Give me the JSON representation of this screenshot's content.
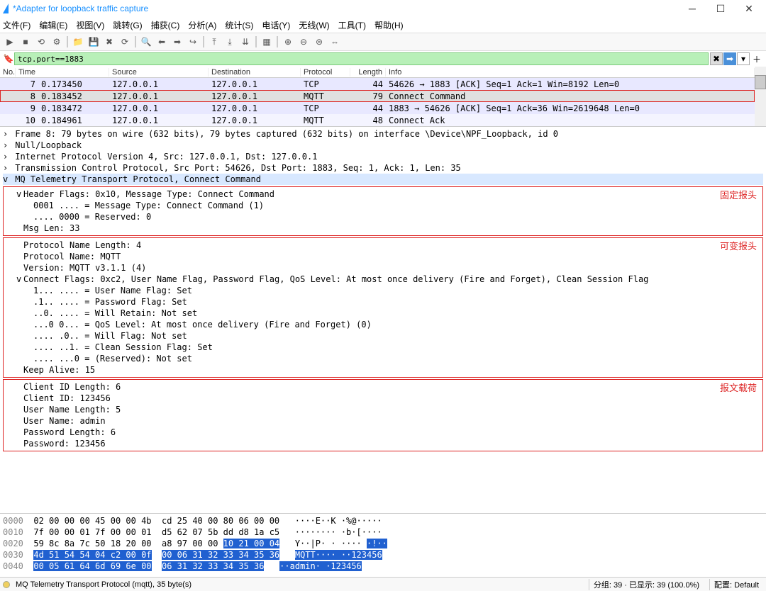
{
  "title": "*Adapter for loopback traffic capture",
  "menu": [
    "文件(F)",
    "编辑(E)",
    "视图(V)",
    "跳转(G)",
    "捕获(C)",
    "分析(A)",
    "统计(S)",
    "电话(Y)",
    "无线(W)",
    "工具(T)",
    "帮助(H)"
  ],
  "filter": "tcp.port==1883",
  "columns": [
    "No.",
    "Time",
    "Source",
    "Destination",
    "Protocol",
    "Length",
    "Info"
  ],
  "packets": [
    {
      "no": "7",
      "time": "0.173450",
      "src": "127.0.0.1",
      "dst": "127.0.0.1",
      "proto": "TCP",
      "len": "44",
      "info": "54626 → 1883 [ACK] Seq=1 Ack=1 Win=8192 Len=0",
      "cls": "odd"
    },
    {
      "no": "8",
      "time": "0.183452",
      "src": "127.0.0.1",
      "dst": "127.0.0.1",
      "proto": "MQTT",
      "len": "79",
      "info": "Connect Command",
      "cls": "selected sel-border"
    },
    {
      "no": "9",
      "time": "0.183472",
      "src": "127.0.0.1",
      "dst": "127.0.0.1",
      "proto": "TCP",
      "len": "44",
      "info": "1883 → 54626 [ACK] Seq=1 Ack=36 Win=2619648 Len=0",
      "cls": "odd"
    },
    {
      "no": "10",
      "time": "0.184961",
      "src": "127.0.0.1",
      "dst": "127.0.0.1",
      "proto": "MQTT",
      "len": "48",
      "info": "Connect Ack",
      "cls": "even"
    }
  ],
  "details_top": [
    "Frame 8: 79 bytes on wire (632 bits), 79 bytes captured (632 bits) on interface \\Device\\NPF_Loopback, id 0",
    "Null/Loopback",
    "Internet Protocol Version 4, Src: 127.0.0.1, Dst: 127.0.0.1",
    "Transmission Control Protocol, Src Port: 54626, Dst Port: 1883, Seq: 1, Ack: 1, Len: 35"
  ],
  "details_hl": "MQ Telemetry Transport Protocol, Connect Command",
  "box1_label": "固定报头",
  "box1_lines": [
    {
      "lvl": 1,
      "tri": "v",
      "text": "Header Flags: 0x10, Message Type: Connect Command"
    },
    {
      "lvl": 2,
      "tri": "",
      "text": "0001 .... = Message Type: Connect Command (1)"
    },
    {
      "lvl": 2,
      "tri": "",
      "text": ".... 0000 = Reserved: 0"
    },
    {
      "lvl": 1,
      "tri": "",
      "text": "Msg Len: 33"
    }
  ],
  "box2_label": "可变报头",
  "box2_lines": [
    {
      "lvl": 1,
      "tri": "",
      "text": "Protocol Name Length: 4"
    },
    {
      "lvl": 1,
      "tri": "",
      "text": "Protocol Name: MQTT"
    },
    {
      "lvl": 1,
      "tri": "",
      "text": "Version: MQTT v3.1.1 (4)"
    },
    {
      "lvl": 1,
      "tri": "v",
      "text": "Connect Flags: 0xc2, User Name Flag, Password Flag, QoS Level: At most once delivery (Fire and Forget), Clean Session Flag"
    },
    {
      "lvl": 2,
      "tri": "",
      "text": "1... .... = User Name Flag: Set"
    },
    {
      "lvl": 2,
      "tri": "",
      "text": ".1.. .... = Password Flag: Set"
    },
    {
      "lvl": 2,
      "tri": "",
      "text": "..0. .... = Will Retain: Not set"
    },
    {
      "lvl": 2,
      "tri": "",
      "text": "...0 0... = QoS Level: At most once delivery (Fire and Forget) (0)"
    },
    {
      "lvl": 2,
      "tri": "",
      "text": ".... .0.. = Will Flag: Not set"
    },
    {
      "lvl": 2,
      "tri": "",
      "text": ".... ..1. = Clean Session Flag: Set"
    },
    {
      "lvl": 2,
      "tri": "",
      "text": ".... ...0 = (Reserved): Not set"
    },
    {
      "lvl": 1,
      "tri": "",
      "text": "Keep Alive: 15"
    }
  ],
  "box3_label": "报文载荷",
  "box3_lines": [
    {
      "lvl": 1,
      "tri": "",
      "text": "Client ID Length: 6"
    },
    {
      "lvl": 1,
      "tri": "",
      "text": "Client ID: 123456"
    },
    {
      "lvl": 1,
      "tri": "",
      "text": "User Name Length: 5"
    },
    {
      "lvl": 1,
      "tri": "",
      "text": "User Name: admin"
    },
    {
      "lvl": 1,
      "tri": "",
      "text": "Password Length: 6"
    },
    {
      "lvl": 1,
      "tri": "",
      "text": "Password: 123456"
    }
  ],
  "hex": [
    {
      "addr": "0000",
      "b1": "02 00 00 00 45 00 00 4b",
      "b2": "cd 25 40 00 80 06 00 00",
      "ascii": "····E··K ·%@·····"
    },
    {
      "addr": "0010",
      "b1": "7f 00 00 01 7f 00 00 01",
      "b2": "d5 62 07 5b dd d8 1a c5",
      "ascii": "········ ·b·[····"
    },
    {
      "addr": "0020",
      "b1": "59 8c 8a 7c 50 18 20 00",
      "b2": "a8 97 00 00 ",
      "b2hl": "10 21 00 04",
      "ascii": "Y··|P· · ···· ",
      "asciihl": "·!··"
    },
    {
      "addr": "0030",
      "b1hl": "4d 51 54 54 04 c2 00 0f",
      "b2hl": "00 06 31 32 33 34 35 36",
      "asciihl": "MQTT···· ··123456"
    },
    {
      "addr": "0040",
      "b1hl": "00 05 61 64 6d 69 6e 00",
      "b2hl": "06 31 32 33 34 35 36",
      "asciihl": "··admin· ·123456"
    }
  ],
  "status": {
    "proto": "MQ Telemetry Transport Protocol (mqtt), 35 byte(s)",
    "pkts": "分组: 39 · 已显示: 39 (100.0%)",
    "profile": "配置: Default"
  }
}
